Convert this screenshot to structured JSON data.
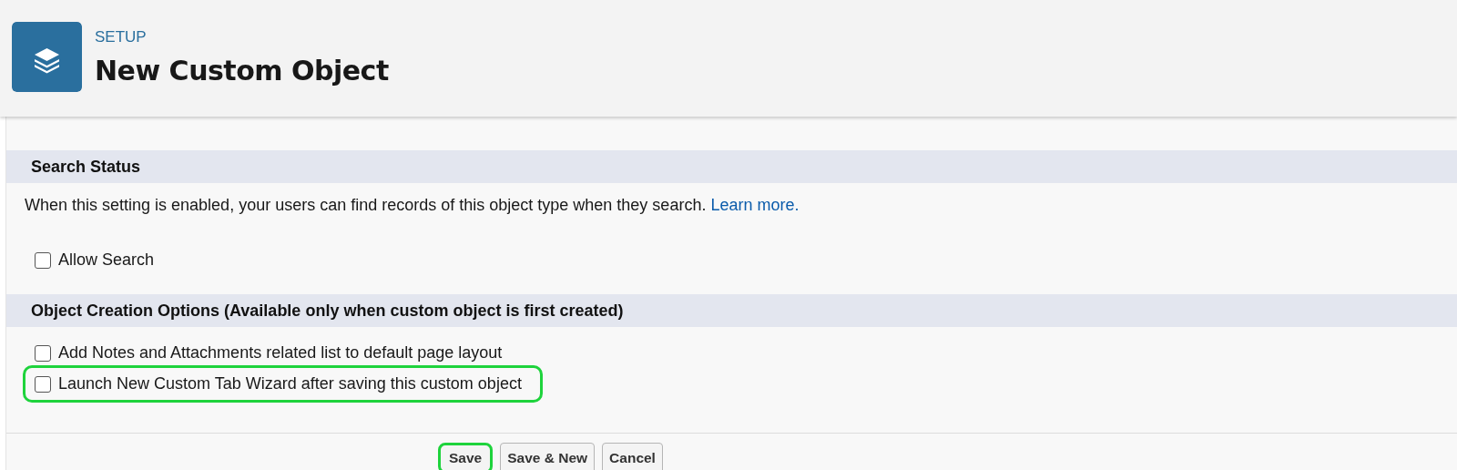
{
  "header": {
    "eyebrow": "SETUP",
    "title": "New Custom Object"
  },
  "sections": [
    {
      "title": "Search Status",
      "description": "When this setting is enabled, your users can find records of this object type when they search.",
      "link": "Learn more.",
      "options": [
        {
          "label": "Allow Search",
          "checked": false,
          "highlighted": false
        }
      ]
    },
    {
      "title": "Object Creation Options (Available only when custom object is first created)",
      "options": [
        {
          "label": "Add Notes and Attachments related list to default page layout",
          "checked": false,
          "highlighted": false
        },
        {
          "label": "Launch New Custom Tab Wizard after saving this custom object",
          "checked": false,
          "highlighted": true
        }
      ]
    }
  ],
  "buttons": [
    {
      "label": "Save",
      "highlighted": true
    },
    {
      "label": "Save & New",
      "highlighted": false
    },
    {
      "label": "Cancel",
      "highlighted": false
    }
  ]
}
